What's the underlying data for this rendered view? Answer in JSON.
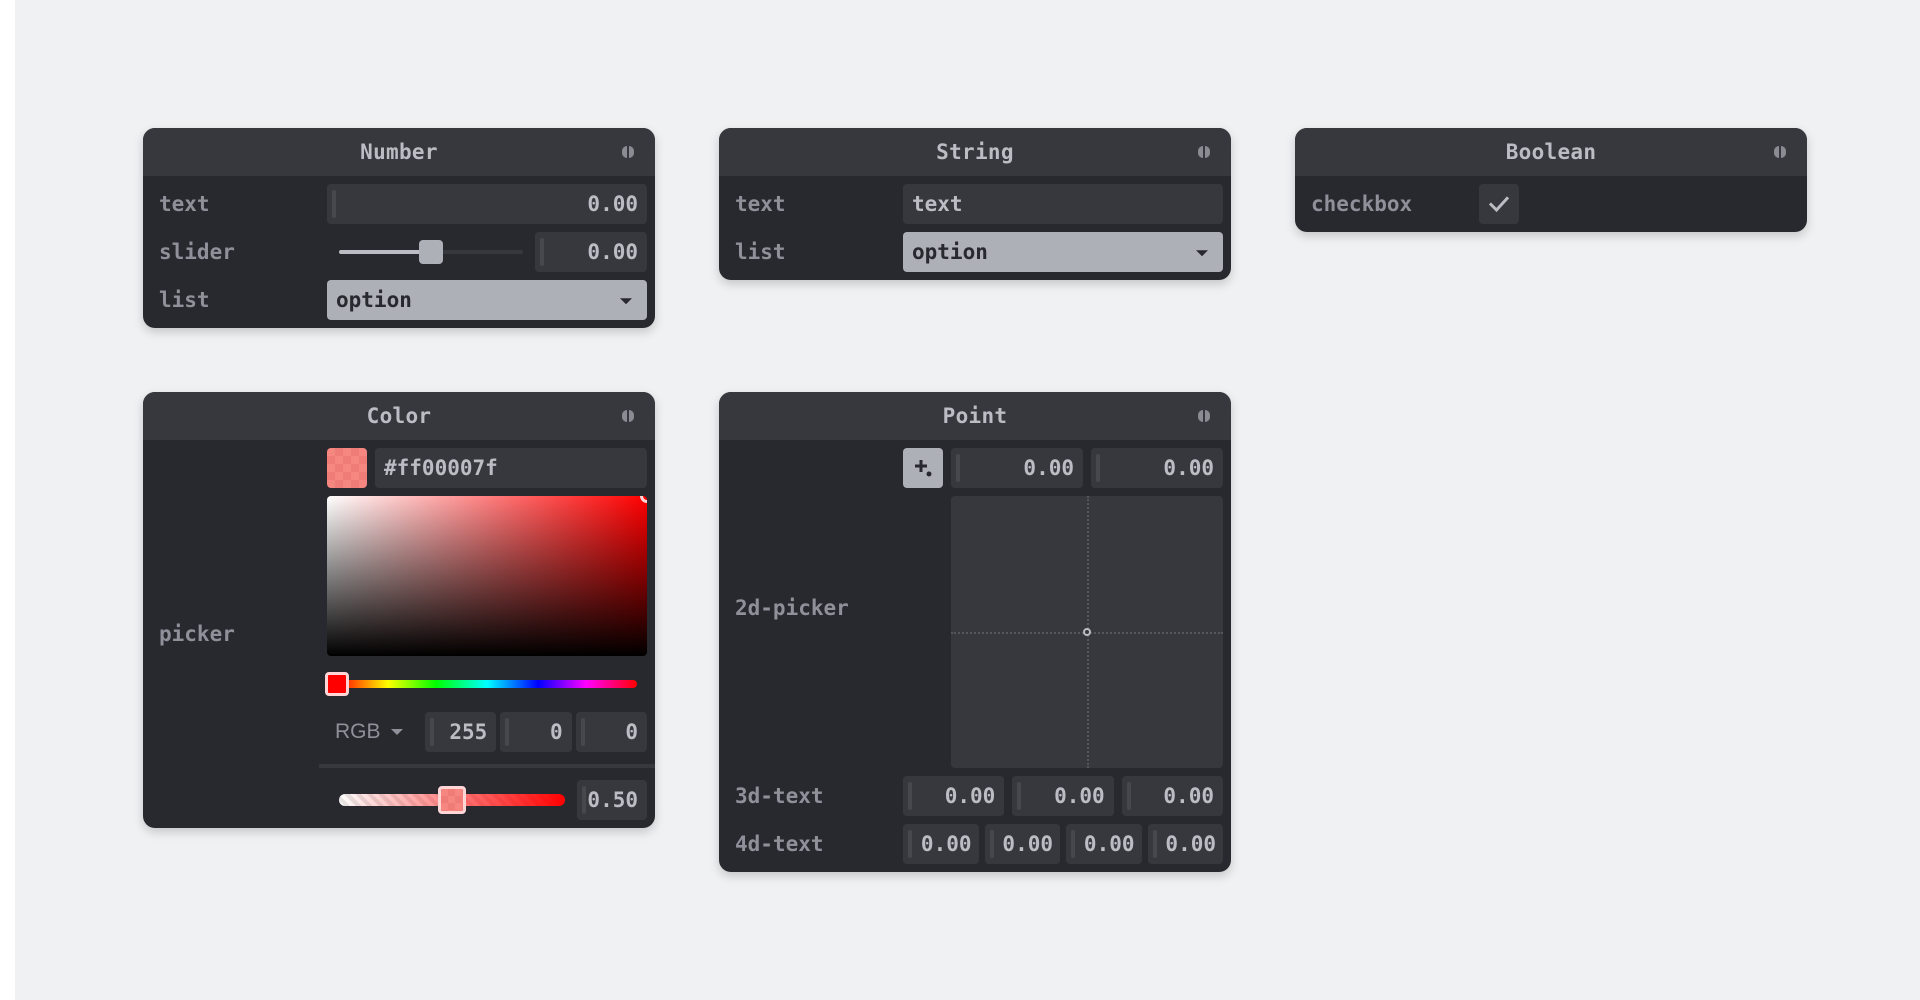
{
  "panes": {
    "number": {
      "title": "Number",
      "rows": {
        "text": {
          "label": "text",
          "value": "0.00"
        },
        "slider": {
          "label": "slider",
          "value": "0.00",
          "position": 0.5
        },
        "list": {
          "label": "list",
          "selected": "option"
        }
      }
    },
    "string": {
      "title": "String",
      "rows": {
        "text": {
          "label": "text",
          "value": "text"
        },
        "list": {
          "label": "list",
          "selected": "option"
        }
      }
    },
    "boolean": {
      "title": "Boolean",
      "rows": {
        "checkbox": {
          "label": "checkbox",
          "checked": true
        }
      }
    },
    "color": {
      "title": "Color",
      "label": "picker",
      "hex": "#ff00007f",
      "swatch_color": "#ff0000",
      "mode": "RGB",
      "rgb": [
        "255",
        "0",
        "0"
      ],
      "alpha": "0.50",
      "alpha_position": 0.5,
      "hue_position": 0,
      "saturation": 1,
      "brightness": 1
    },
    "point": {
      "title": "Point",
      "picker": {
        "label": "2d-picker",
        "x": "0.00",
        "y": "0.00",
        "pad_x": 0.5,
        "pad_y": 0.5
      },
      "text3d": {
        "label": "3d-text",
        "values": [
          "0.00",
          "0.00",
          "0.00"
        ]
      },
      "text4d": {
        "label": "4d-text",
        "values": [
          "0.00",
          "0.00",
          "0.00",
          "0.00"
        ]
      }
    }
  },
  "icons": {
    "fold": "fold-icon",
    "checkmark": "check-icon",
    "pad_toggle": "crosshair-plus-icon",
    "dropdown": "caret-down-icon"
  },
  "colors": {
    "background": "#f0f1f3",
    "pane_bg": "#28292e",
    "header_bg": "#37383d",
    "input_bg": "#37383d",
    "select_bg": "#aeb0b8",
    "text": "#bbbcc4",
    "label": "#8f9099"
  }
}
